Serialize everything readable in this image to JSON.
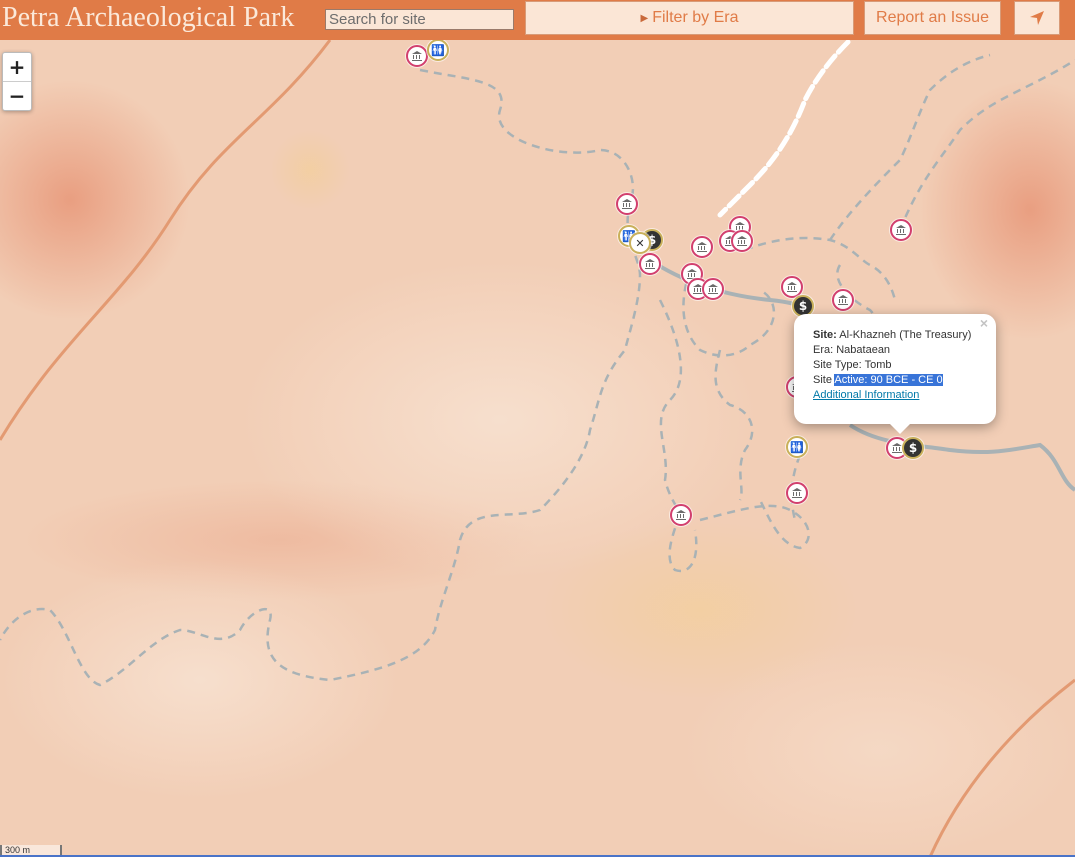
{
  "header": {
    "title": "Petra Archaeological Park",
    "search_placeholder": "Search for site",
    "filter_label": "Filter by Era",
    "report_label": "Report an Issue",
    "locate_icon": "location-arrow-icon"
  },
  "map": {
    "zoom_in": "+",
    "zoom_out": "−",
    "scale_label": "300 m",
    "colors": {
      "site_marker": "#d23f6e",
      "amenity_marker": "#c9b05a",
      "trail": "#a9b2b5",
      "road": "#e39a72",
      "header": "#e07b47"
    }
  },
  "popup": {
    "site_label": "Site:",
    "site_value": "Al-Khazneh (The Treasury)",
    "era_line": "Era: Nabataean",
    "type_line": "Site Type: Tomb",
    "active_prefix": "Site ",
    "active_selected": "Active: 90 BCE - CE 0",
    "link": "Additional Information",
    "close": "×"
  }
}
